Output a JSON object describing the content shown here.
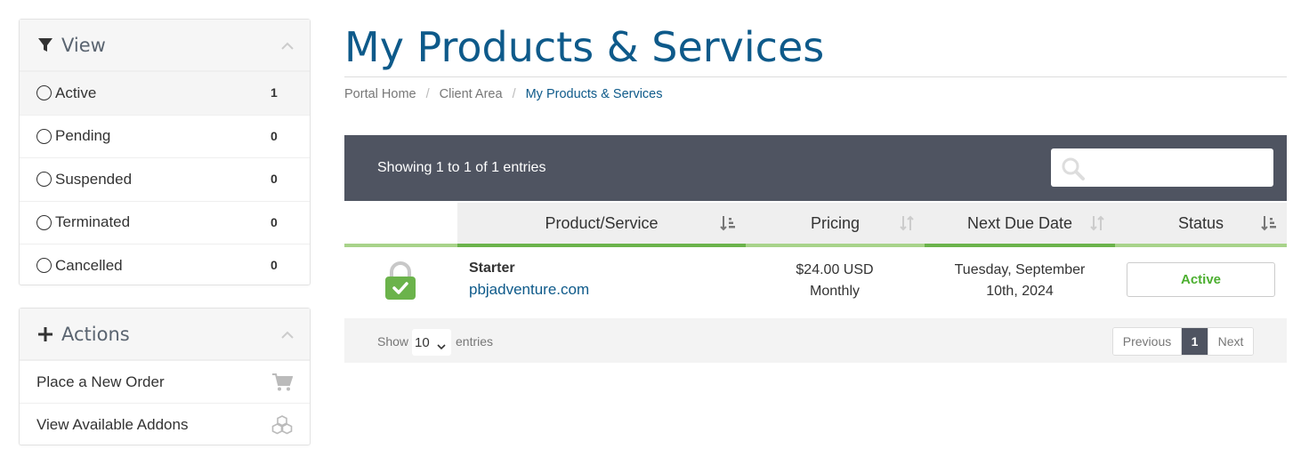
{
  "sidebar": {
    "view": {
      "title": "View",
      "items": [
        {
          "label": "Active",
          "count": "1"
        },
        {
          "label": "Pending",
          "count": "0"
        },
        {
          "label": "Suspended",
          "count": "0"
        },
        {
          "label": "Terminated",
          "count": "0"
        },
        {
          "label": "Cancelled",
          "count": "0"
        }
      ]
    },
    "actions": {
      "title": "Actions",
      "items": [
        {
          "label": "Place a New Order",
          "icon": "cart-icon"
        },
        {
          "label": "View Available Addons",
          "icon": "cubes-icon"
        }
      ]
    }
  },
  "main": {
    "title": "My Products & Services",
    "breadcrumb": [
      {
        "label": "Portal Home"
      },
      {
        "label": "Client Area"
      },
      {
        "label": "My Products & Services"
      }
    ],
    "table": {
      "showing": "Showing 1 to 1 of 1 entries",
      "search_placeholder": "",
      "columns": [
        {
          "label": ""
        },
        {
          "label": "Product/Service"
        },
        {
          "label": "Pricing"
        },
        {
          "label": "Next Due Date"
        },
        {
          "label": "Status"
        }
      ],
      "rows": [
        {
          "product": "Starter",
          "domain": "pbjadventure.com",
          "price": "$24.00 USD",
          "cycle": "Monthly",
          "due_line1": "Tuesday, September",
          "due_line2": "10th, 2024",
          "status": "Active"
        }
      ],
      "footer": {
        "show": "Show",
        "length": "10",
        "entries": "entries",
        "previous": "Previous",
        "page": "1",
        "next": "Next"
      }
    }
  },
  "colors": {
    "title_blue": "#0e5a8a",
    "header_dark": "#4f5461",
    "accent_green": "#6bb34b",
    "light_green": "#a8d38a",
    "status_green": "#4caf30"
  }
}
